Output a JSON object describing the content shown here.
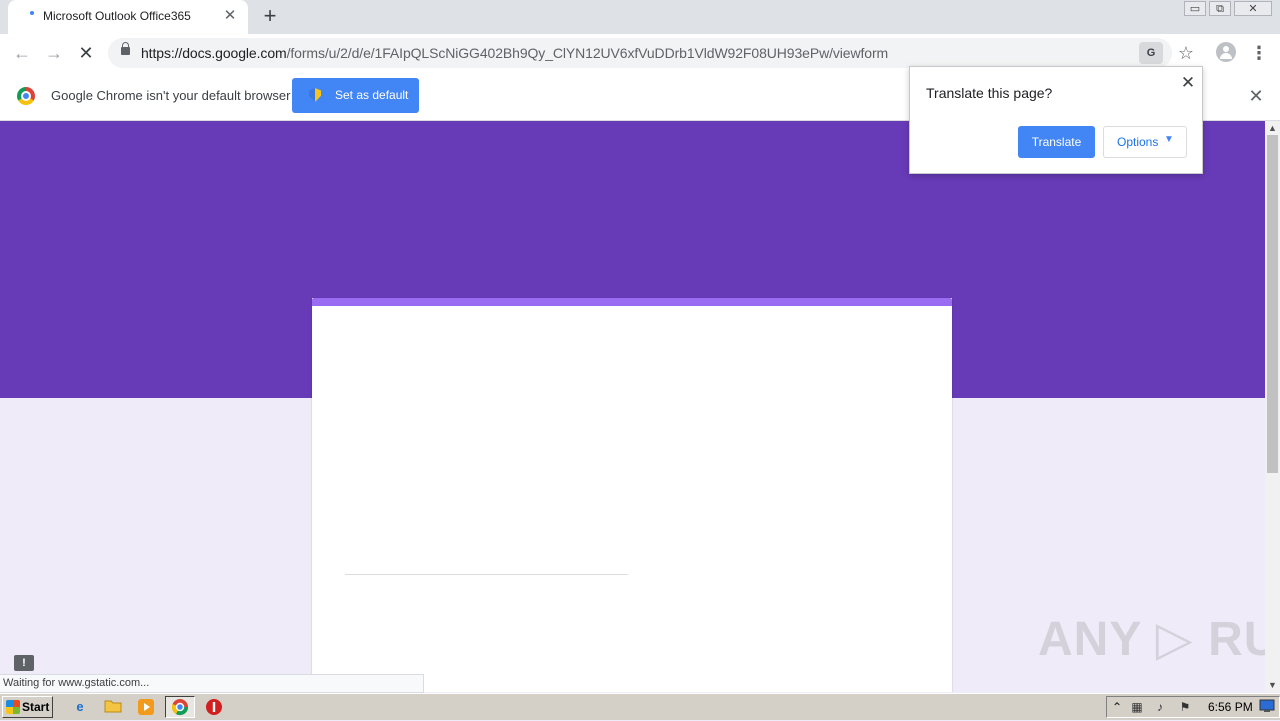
{
  "browser": {
    "tab": {
      "title": "Microsoft Outlook Office365",
      "close": "✕"
    },
    "new_tab": "+",
    "window_controls": [
      "▭",
      "⧉",
      "✕"
    ],
    "nav": {
      "back": "←",
      "forward": "→",
      "reload": "✕"
    },
    "omnibox": {
      "url_host": "https://docs.google.com",
      "url_path": "/forms/u/2/d/e/1FAIpQLScNiGG402Bh9Qy_ClYN12UV6xfVuDDrb1VldW92F08UH93ePw/viewform",
      "translate_icon": "translate-icon",
      "star": "☆",
      "menu": "⋮"
    }
  },
  "infobar": {
    "text": "Google Chrome isn't your default browser",
    "button_label": "Set as default",
    "close": "✕"
  },
  "translate_popup": {
    "title": "Translate this page?",
    "close": "✕",
    "translate_label": "Translate",
    "options_label": "Options",
    "options_caret": "▼"
  },
  "page": {
    "header_color": "#673ab7",
    "accent_color": "#9a6cf2",
    "background_color": "#f0ebf8",
    "feedback_icon": "!",
    "watermark": "ANY ▷ RUN"
  },
  "scrollbar": {
    "up": "▲",
    "down": "▼"
  },
  "status_bar": {
    "text": "Waiting for www.gstatic.com..."
  },
  "taskbar": {
    "start_label": "Start",
    "icons": [
      "ie-icon",
      "folder-icon",
      "media-player-icon",
      "chrome-icon",
      "stop-icon"
    ],
    "tray_icons": [
      "show-hidden-icon",
      "network-icon",
      "volume-icon",
      "flag-icon",
      "monitor-icon"
    ],
    "clock": "6:56 PM"
  }
}
